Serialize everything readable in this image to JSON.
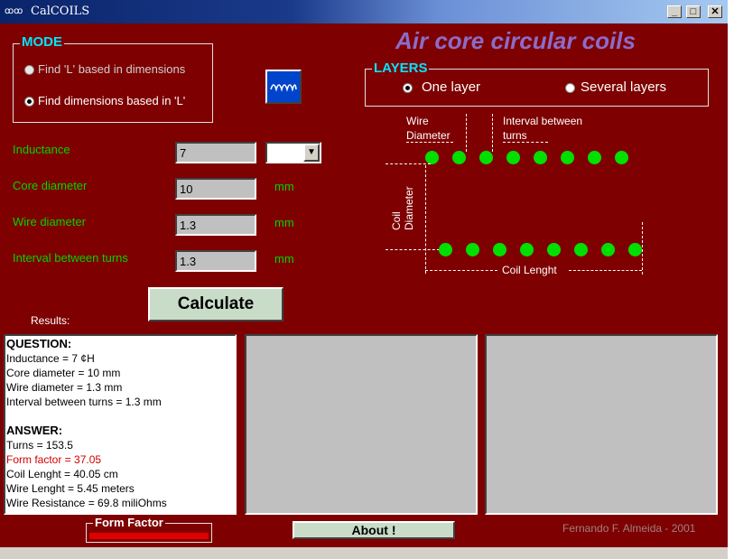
{
  "window": {
    "title": "CalCOILS",
    "icon": "coil-app-icon",
    "min": "_",
    "max": "□",
    "close": "✕"
  },
  "header": {
    "title": "Air core circular coils"
  },
  "mode": {
    "legend": "MODE",
    "options": [
      {
        "label": "Find 'L' based in dimensions",
        "selected": false
      },
      {
        "label": "Find dimensions based in 'L'",
        "selected": true
      }
    ]
  },
  "layers": {
    "legend": "LAYERS",
    "options": [
      {
        "label": "One layer",
        "selected": true
      },
      {
        "label": "Several layers",
        "selected": false
      }
    ]
  },
  "inputs": [
    {
      "label": "Inductance",
      "value": "7",
      "unit": ""
    },
    {
      "label": "Core diameter",
      "value": "10",
      "unit": "mm"
    },
    {
      "label": "Wire diameter",
      "value": "1.3",
      "unit": "mm"
    },
    {
      "label": "Interval between turns",
      "value": "1.3",
      "unit": "mm"
    }
  ],
  "unit_select": {
    "value": "",
    "arrow": "▼"
  },
  "diagram": {
    "wire_diameter": "Wire\nDiameter",
    "interval": "Interval between\nturns",
    "coil_diameter": "Coil\nDiameter",
    "coil_length": "Coil Lenght",
    "top_dots": 8,
    "bottom_dots": 8
  },
  "calculate_label": "Calculate",
  "results_label": "Results:",
  "results": {
    "question_header": "QUESTION:",
    "question_lines": [
      "Inductance = 7 ¢H",
      "Core diameter = 10 mm",
      "Wire diameter = 1.3 mm",
      "Interval between turns = 1.3 mm"
    ],
    "answer_header": "ANSWER:",
    "turns": "Turns = 153.5",
    "form_factor": "Form factor = 37.05",
    "answer_lines": [
      "Coil Lenght = 40.05 cm",
      "Wire Lenght = 5.45 meters",
      "Wire Resistance = 69.8 miliOhms"
    ]
  },
  "form_factor_label": "Form Factor",
  "about_label": "About !",
  "credit": "Fernando F. Almeida - 2001",
  "colors": {
    "background": "#7e0000",
    "accent_cyan": "#00e5ff",
    "label_green": "#00d400",
    "dot_green": "#00e000",
    "title_purple": "#8c6cc8",
    "form_bar": "#e00000"
  }
}
